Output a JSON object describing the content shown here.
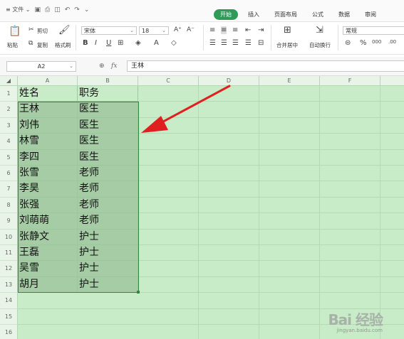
{
  "menu": {
    "file_label": "≡ 文件 ⌄",
    "tabs": [
      "开始",
      "插入",
      "页面布局",
      "公式",
      "数据",
      "审阅"
    ]
  },
  "ribbon": {
    "paste_label": "粘贴",
    "cut_label": "剪切",
    "copy_label": "复制",
    "format_painter_label": "格式刷",
    "font_name": "宋体",
    "font_size": "18",
    "merge_center_label": "合并居中",
    "wrap_text_label": "自动换行",
    "number_format": "常规",
    "percent_label": "%"
  },
  "formula_bar": {
    "cell_ref": "A2",
    "fx_label": "fx",
    "content": "王林"
  },
  "sheet": {
    "columns": [
      "A",
      "B",
      "C",
      "D",
      "E",
      "F"
    ],
    "row_numbers": [
      "1",
      "2",
      "3",
      "4",
      "5",
      "6",
      "7",
      "8",
      "9",
      "10",
      "11",
      "12",
      "13",
      "14",
      "15",
      "16"
    ],
    "rows": [
      [
        "姓名",
        "职务"
      ],
      [
        "王林",
        "医生"
      ],
      [
        "刘伟",
        "医生"
      ],
      [
        "林雪",
        "医生"
      ],
      [
        "李四",
        "医生"
      ],
      [
        "张雪",
        "老师"
      ],
      [
        "李昊",
        "老师"
      ],
      [
        "张强",
        "老师"
      ],
      [
        "刘萌萌",
        "老师"
      ],
      [
        "张静文",
        "护士"
      ],
      [
        "王磊",
        "护士"
      ],
      [
        "吴雪",
        "护士"
      ],
      [
        "胡月",
        "护士"
      ]
    ],
    "selection": "A2:B13"
  },
  "annotation": {
    "arrow_color": "#e02020"
  },
  "watermark": {
    "brand": "Bai 经验",
    "url": "jingyan.baidu.com"
  },
  "colors": {
    "grid_bg": "#c8ebc8",
    "selected_bg": "#a6cca6",
    "accent": "#2e9b58"
  }
}
